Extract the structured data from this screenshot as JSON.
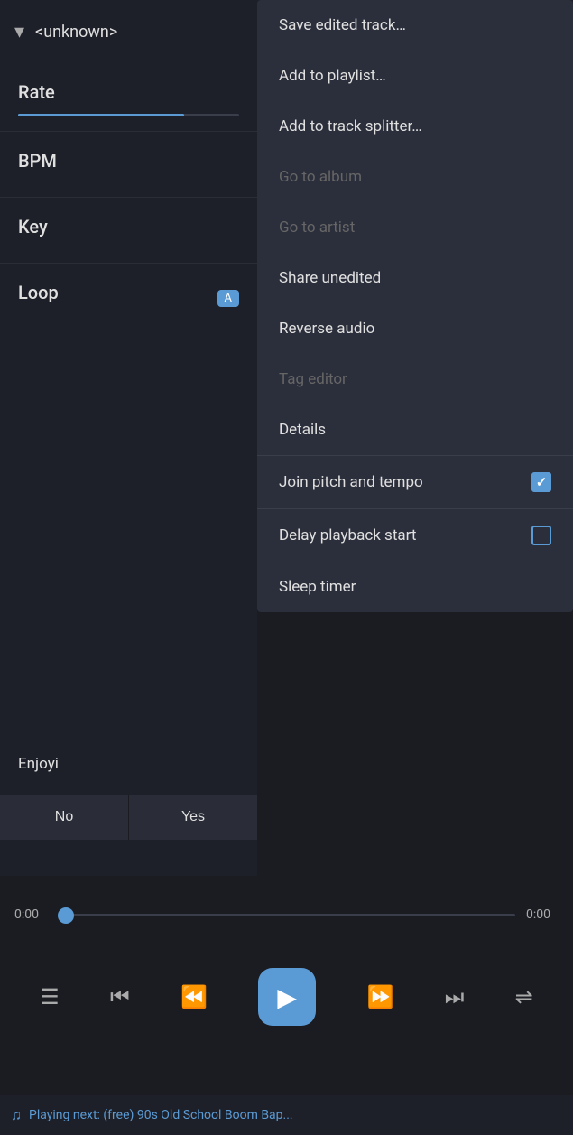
{
  "header": {
    "chevron": "▾",
    "title": "<unknown>"
  },
  "left_panel": {
    "rate_label": "Rate",
    "bpm_label": "BPM",
    "key_label": "Key",
    "loop_label": "Loop",
    "loop_badge": "A",
    "slider_fill_percent": 75
  },
  "enjoy": {
    "text": "Enjoyi"
  },
  "buttons": {
    "no_label": "No",
    "yes_label": "Yes"
  },
  "progress": {
    "start_time": "0:00",
    "end_time": "0:00"
  },
  "controls": {
    "queue_icon": "☰",
    "prev_icon": "⏮",
    "rewind_icon": "⏪",
    "play_icon": "▶",
    "fast_forward_icon": "⏩",
    "next_icon": "⏭",
    "shuffle_icon": "⇌"
  },
  "bottom_bar": {
    "icon": "♫",
    "text": "Playing next: (free) 90s Old School Boom Bap..."
  },
  "menu": {
    "items": [
      {
        "label": "Save edited track…",
        "disabled": false,
        "has_checkbox": false
      },
      {
        "label": "Add to playlist…",
        "disabled": false,
        "has_checkbox": false
      },
      {
        "label": "Add to track splitter…",
        "disabled": false,
        "has_checkbox": false
      },
      {
        "label": "Go to album",
        "disabled": true,
        "has_checkbox": false
      },
      {
        "label": "Go to artist",
        "disabled": true,
        "has_checkbox": false
      },
      {
        "label": "Share unedited",
        "disabled": false,
        "has_checkbox": false
      },
      {
        "label": "Reverse audio",
        "disabled": false,
        "has_checkbox": false
      },
      {
        "label": "Tag editor",
        "disabled": true,
        "has_checkbox": false
      },
      {
        "label": "Details",
        "disabled": false,
        "has_checkbox": false
      },
      {
        "label": "Join pitch and tempo",
        "disabled": false,
        "has_checkbox": true,
        "checked": true
      },
      {
        "label": "Delay playback start",
        "disabled": false,
        "has_checkbox": true,
        "checked": false
      },
      {
        "label": "Sleep timer",
        "disabled": false,
        "has_checkbox": false
      }
    ]
  }
}
